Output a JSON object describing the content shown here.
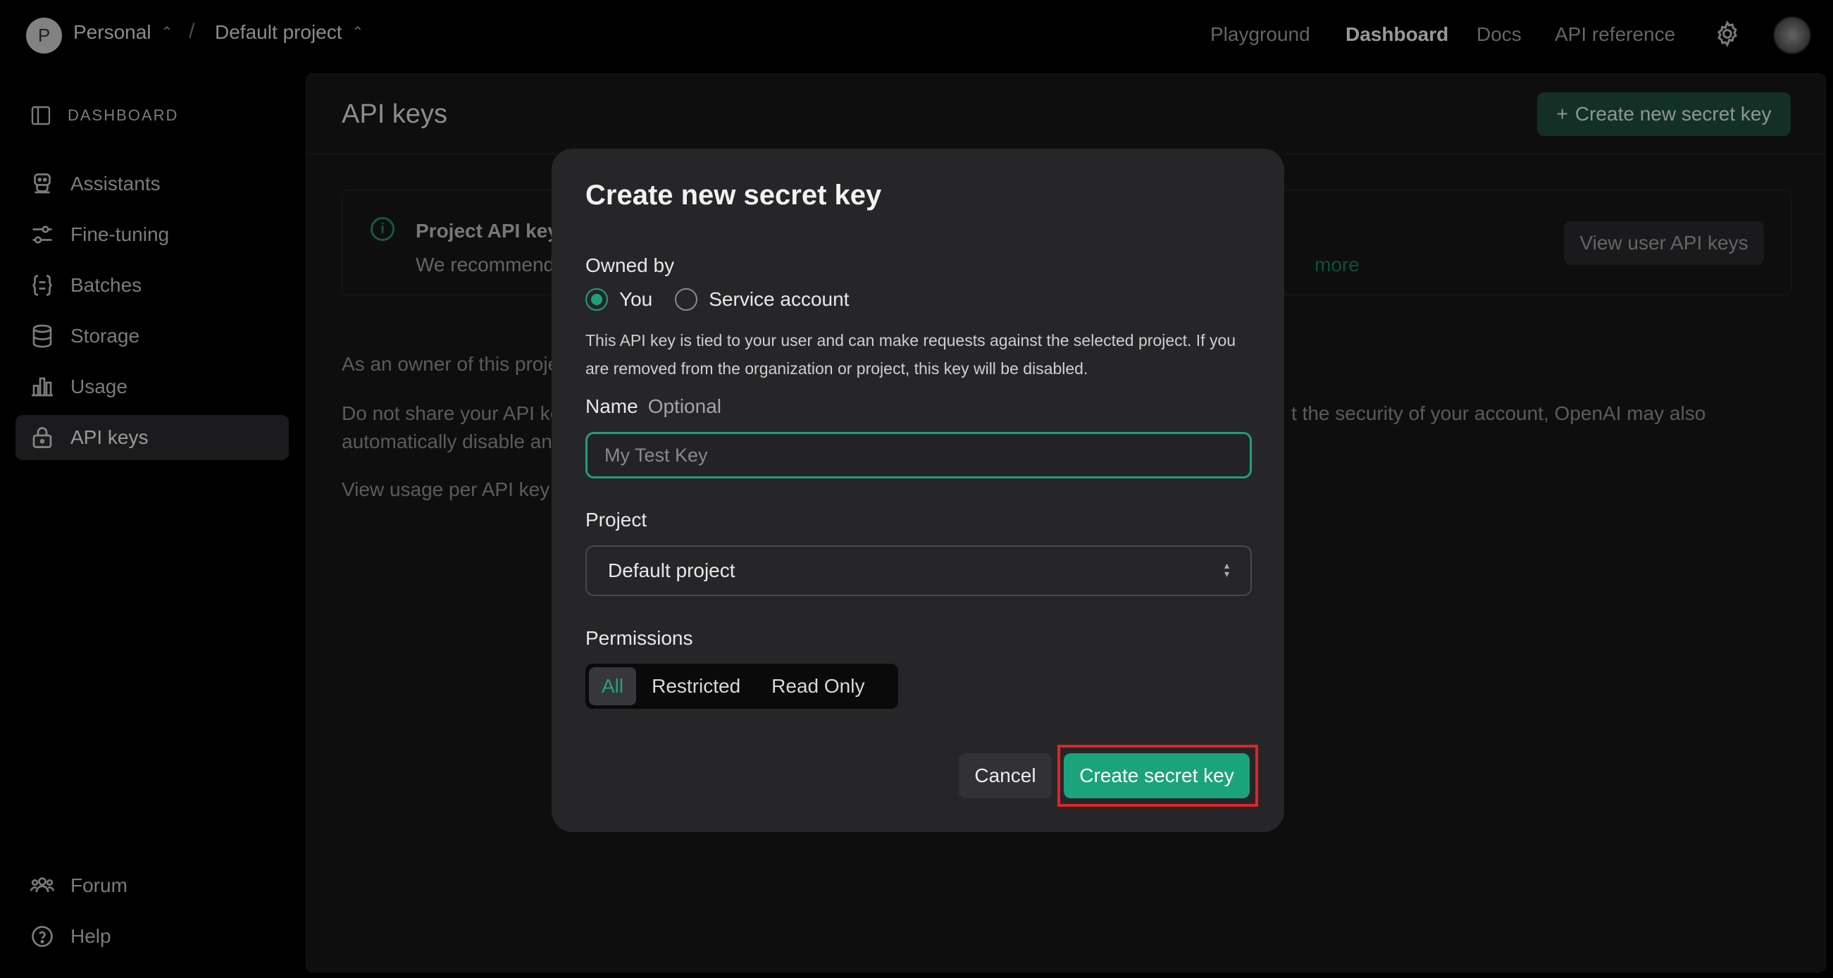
{
  "topbar": {
    "org_initial": "P",
    "org_name": "Personal",
    "separator": "/",
    "project_name": "Default project",
    "nav": [
      "Playground",
      "Dashboard",
      "Docs",
      "API reference"
    ],
    "active_nav": "Dashboard"
  },
  "sidebar": {
    "header": "DASHBOARD",
    "items": [
      {
        "label": "Assistants",
        "icon": "robot-icon"
      },
      {
        "label": "Fine-tuning",
        "icon": "sliders-icon"
      },
      {
        "label": "Batches",
        "icon": "braces-icon"
      },
      {
        "label": "Storage",
        "icon": "database-icon"
      },
      {
        "label": "Usage",
        "icon": "bar-chart-icon"
      },
      {
        "label": "API keys",
        "icon": "lock-icon",
        "active": true
      }
    ],
    "footer": [
      {
        "label": "Forum",
        "icon": "users-icon"
      },
      {
        "label": "Help",
        "icon": "help-icon"
      }
    ]
  },
  "main": {
    "title": "API keys",
    "create_button": "Create new secret key",
    "info": {
      "title": "Project API key",
      "text": "We recommend",
      "link": "more",
      "button": "View user API keys"
    },
    "paragraphs": [
      "As an owner of this proje",
      "Do not share your API ke",
      "automatically disable an",
      "View usage per API key o"
    ],
    "paragraph_right": "t the security of your account, OpenAI may also"
  },
  "modal": {
    "title": "Create new secret key",
    "owned_by_label": "Owned by",
    "owner_options": [
      "You",
      "Service account"
    ],
    "owner_selected": "You",
    "owner_description": "This API key is tied to your user and can make requests against the selected project. If you are removed from the organization or project, this key will be disabled.",
    "name_label": "Name",
    "name_optional": "Optional",
    "name_placeholder": "My Test Key",
    "name_value": "",
    "project_label": "Project",
    "project_value": "Default project",
    "permissions_label": "Permissions",
    "permissions": [
      "All",
      "Restricted",
      "Read Only"
    ],
    "permissions_selected": "All",
    "cancel": "Cancel",
    "submit": "Create secret key"
  },
  "colors": {
    "accent": "#1aa37c",
    "highlight": "#e02424",
    "background": "#000000",
    "panel": "#161618",
    "modal": "#262629"
  }
}
